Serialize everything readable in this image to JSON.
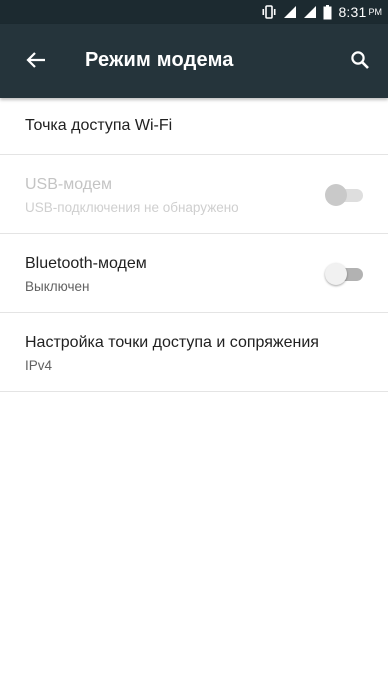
{
  "status_bar": {
    "time": "8:31",
    "ampm": "PM",
    "icons": [
      "vibrate-icon",
      "signal-icon",
      "signal-icon",
      "battery-icon"
    ]
  },
  "app_bar": {
    "title": "Режим модема",
    "back_icon": "arrow-left-icon",
    "search_icon": "search-icon"
  },
  "settings": {
    "items": [
      {
        "title": "Точка доступа Wi-Fi"
      },
      {
        "title": "USB-модем",
        "summary": "USB-подключения не обнаружено",
        "enabled": false,
        "checked": false
      },
      {
        "title": "Bluetooth-модем",
        "summary": "Выключен",
        "enabled": true,
        "checked": false
      },
      {
        "title": "Настройка точки доступа и сопряжения",
        "summary": "IPv4"
      }
    ]
  },
  "colors": {
    "status_bar": "#1c2a30",
    "app_bar": "#25343b",
    "divider": "#e4e4e4"
  }
}
